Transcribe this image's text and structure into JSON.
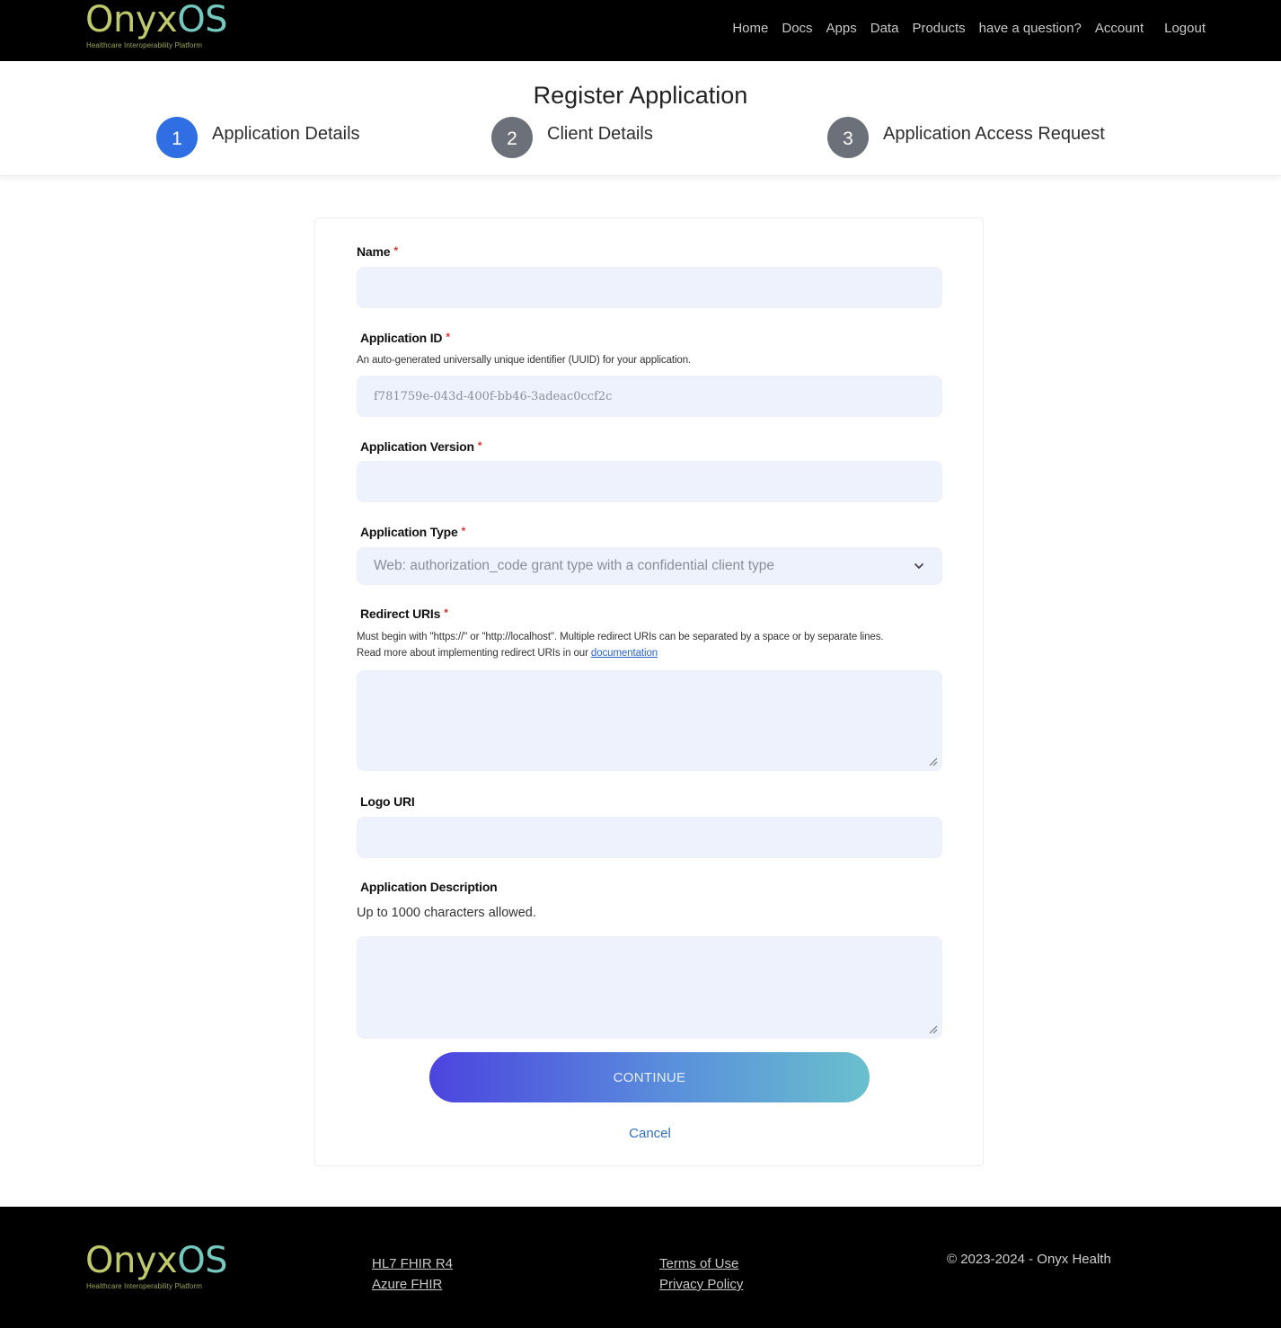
{
  "brand": {
    "logo_part1": "Onyx",
    "logo_part2": "OS",
    "tagline": "Healthcare Interoperability Platform"
  },
  "nav": {
    "items": [
      "Home",
      "Docs",
      "Apps",
      "Data",
      "Products",
      "have a question?",
      "Account"
    ],
    "logout": "Logout"
  },
  "header": {
    "title": "Register Application",
    "steps": [
      {
        "number": "1",
        "label": "Application Details",
        "state": "active"
      },
      {
        "number": "2",
        "label": "Client Details",
        "state": "inactive"
      },
      {
        "number": "3",
        "label": "Application Access Request",
        "state": "inactive"
      }
    ]
  },
  "form": {
    "name": {
      "label": "Name",
      "required": "*",
      "value": ""
    },
    "app_id": {
      "label": "Application ID",
      "required": "*",
      "help": "An auto-generated universally unique identifier (UUID) for your application.",
      "value": "f781759e-043d-400f-bb46-3adeac0ccf2c"
    },
    "app_version": {
      "label": "Application Version",
      "required": "*",
      "value": ""
    },
    "app_type": {
      "label": "Application Type",
      "required": "*",
      "selected": "Web: authorization_code grant type with a confidential client type"
    },
    "redirect_uris": {
      "label": "Redirect URIs",
      "required": "*",
      "help_line1": "Must begin with \"https://\" or \"http://localhost\". Multiple redirect URIs can be separated by a space or by separate lines.",
      "help_line2_prefix": "Read more about implementing redirect URIs in our ",
      "help_link": "documentation",
      "value": ""
    },
    "logo_uri": {
      "label": "Logo URI",
      "value": ""
    },
    "description": {
      "label": "Application Description",
      "help": "Up to 1000 characters allowed.",
      "value": ""
    },
    "continue_label": "CONTINUE",
    "cancel_label": "Cancel"
  },
  "footer": {
    "col1": [
      "HL7 FHIR R4",
      "Azure FHIR"
    ],
    "col2": [
      "Terms of Use",
      "Privacy Policy"
    ],
    "copyright": "© 2023-2024 - Onyx Health"
  },
  "colors": {
    "accent": "#2f6fe3",
    "step_inactive": "#6b7079",
    "field_bg": "#eef2fd",
    "required": "#e0322d",
    "logo_green": "#bfc86a",
    "logo_teal": "#74c9bf"
  }
}
